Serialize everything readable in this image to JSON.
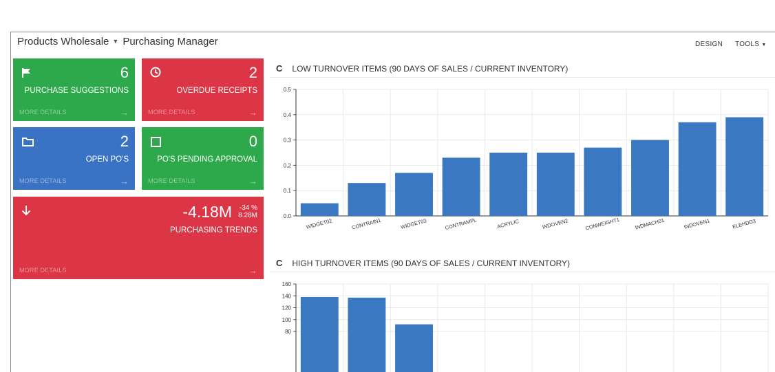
{
  "header": {
    "company": "Products Wholesale",
    "role": "Purchasing Manager",
    "design_label": "DESIGN",
    "tools_label": "TOOLS"
  },
  "tiles": {
    "purchase_suggestions": {
      "value": "6",
      "label": "PURCHASE SUGGESTIONS",
      "more": "MORE DETAILS"
    },
    "overdue_receipts": {
      "value": "2",
      "label": "OVERDUE RECEIPTS",
      "more": "MORE DETAILS"
    },
    "open_pos": {
      "value": "2",
      "label": "OPEN PO'S",
      "more": "MORE DETAILS"
    },
    "pending_approval": {
      "value": "0",
      "label": "PO'S PENDING APPROVAL",
      "more": "MORE DETAILS"
    },
    "purchasing_trends": {
      "value": "-4.18M",
      "pct": "-34 %",
      "prev": "8.28M",
      "label": "PURCHASING TRENDS",
      "more": "MORE DETAILS"
    }
  },
  "colors": {
    "green": "#2da84a",
    "red": "#dc3545",
    "blue": "#3a73c4",
    "bar": "#3a78c2"
  },
  "chart_data": [
    {
      "type": "bar",
      "title": "LOW TURNOVER ITEMS (90 DAYS OF SALES / CURRENT INVENTORY)",
      "categories": [
        "WIDGET02",
        "CONTRAIN1",
        "WIDGET03",
        "CONTRAMPL",
        "ACRYLIC",
        "INDOVEN2",
        "CONWEIGHT1",
        "INDMACH01",
        "INDOVEN1",
        "ELEHDD3"
      ],
      "values": [
        0.05,
        0.13,
        0.17,
        0.23,
        0.25,
        0.25,
        0.27,
        0.3,
        0.37,
        0.39
      ],
      "ylim": [
        0,
        0.5
      ],
      "yticks": [
        "0.0",
        "0.1",
        "0.2",
        "0.3",
        "0.4",
        "0.5"
      ],
      "grid": true
    },
    {
      "type": "bar",
      "title": "HIGH TURNOVER ITEMS (90 DAYS OF SALES / CURRENT INVENTORY)",
      "values": [
        138,
        137,
        92
      ],
      "ylim": [
        0,
        160
      ],
      "yticks": [
        "80",
        "100",
        "120",
        "140",
        "160"
      ],
      "grid": true
    }
  ]
}
